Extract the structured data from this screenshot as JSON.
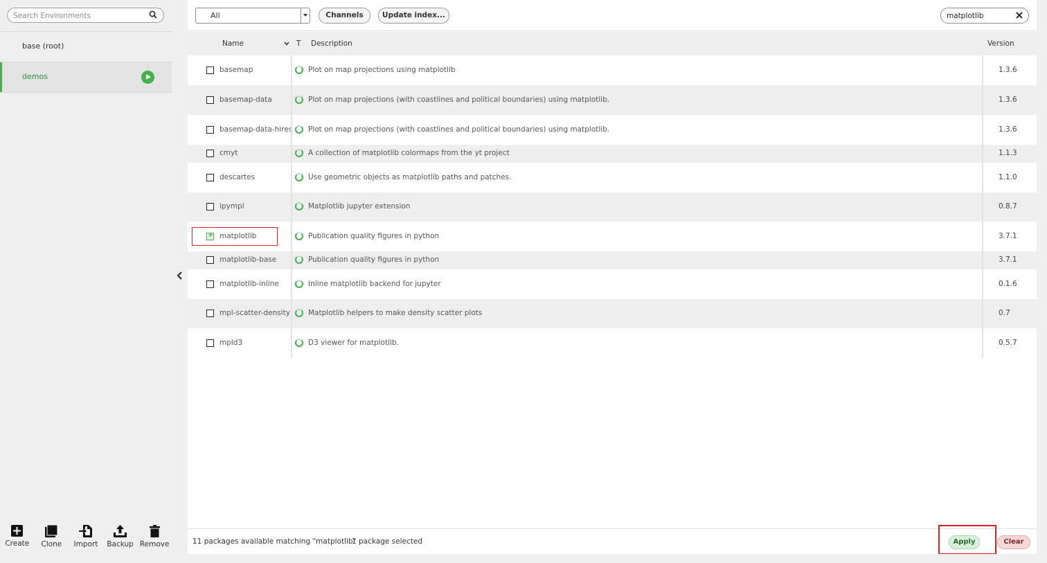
{
  "sidebar": {
    "search_placeholder": "Search Environments",
    "environments": [
      {
        "label": "base (root)",
        "active": false
      },
      {
        "label": "demos",
        "active": true
      }
    ],
    "actions": {
      "create": "Create",
      "clone": "Clone",
      "import": "Import",
      "backup": "Backup",
      "remove": "Remove"
    }
  },
  "toolbar": {
    "filter_value": "All",
    "channels_label": "Channels",
    "update_label": "Update index...",
    "search_value": "matplotlib"
  },
  "table": {
    "headers": {
      "name": "Name",
      "type": "T",
      "description": "Description",
      "version": "Version"
    },
    "rows": [
      {
        "name": "basemap",
        "description": "Plot on map projections using matplotlib",
        "version": "1.3.6",
        "checked": false
      },
      {
        "name": "basemap-data",
        "description": "Plot on map projections (with coastlines and political boundaries) using matplotlib.",
        "version": "1.3.6",
        "checked": false
      },
      {
        "name": "basemap-data-hires",
        "description": "Plot on map projections (with coastlines and political boundaries) using matplotlib.",
        "version": "1.3.6",
        "checked": false
      },
      {
        "name": "cmyt",
        "description": "A collection of matplotlib colormaps from the yt project",
        "version": "1.1.3",
        "checked": false
      },
      {
        "name": "descartes",
        "description": "Use geometric objects as matplotlib paths and patches.",
        "version": "1.1.0",
        "checked": false
      },
      {
        "name": "ipympl",
        "description": "Matplotlib jupyter extension",
        "version": "0.8.7",
        "checked": false
      },
      {
        "name": "matplotlib",
        "description": "Publication quality figures in python",
        "version": "3.7.1",
        "checked": true
      },
      {
        "name": "matplotlib-base",
        "description": "Publication quality figures in python",
        "version": "3.7.1",
        "checked": false
      },
      {
        "name": "matplotlib-inline",
        "description": "Inline matplotlib backend for jupyter",
        "version": "0.1.6",
        "checked": false
      },
      {
        "name": "mpl-scatter-density",
        "description": "Matplotlib helpers to make density scatter plots",
        "version": "0.7",
        "checked": false
      },
      {
        "name": "mpld3",
        "description": "D3 viewer for matplotlib.",
        "version": "0.5.7",
        "checked": false
      }
    ]
  },
  "footer": {
    "match_text": "11 packages available matching \"matplotlib\"",
    "selected_text": "1 package selected",
    "apply_label": "Apply",
    "clear_label": "Clear"
  },
  "colors": {
    "accent_green": "#43b049",
    "highlight_red": "#e02020"
  }
}
